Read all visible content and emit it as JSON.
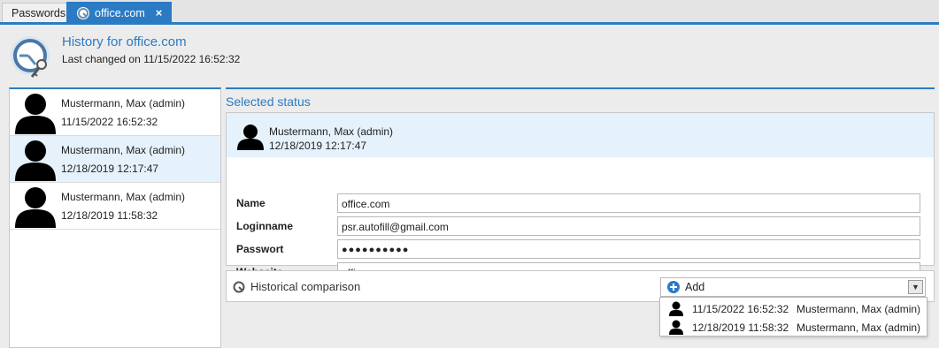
{
  "tabs": [
    {
      "label": "Passwords"
    },
    {
      "label": "office.com",
      "close": "×"
    }
  ],
  "header": {
    "title": "History for office.com",
    "subtitle": "Last changed on 11/15/2022 16:52:32"
  },
  "history": [
    {
      "user": "Mustermann, Max (admin)",
      "date": "11/15/2022 16:52:32"
    },
    {
      "user": "Mustermann, Max (admin)",
      "date": "12/18/2019 12:17:47"
    },
    {
      "user": "Mustermann, Max (admin)",
      "date": "12/18/2019 11:58:32"
    }
  ],
  "selected_status": {
    "title": "Selected status",
    "user": "Mustermann, Max (admin)",
    "date": "12/18/2019 12:17:47",
    "fields": [
      {
        "label": "Name",
        "value": "office.com"
      },
      {
        "label": "Loginname",
        "value": "psr.autofill@gmail.com"
      },
      {
        "label": "Passwort",
        "value": "●●●●●●●●●●"
      },
      {
        "label": "Webseite",
        "value": "office.com"
      }
    ]
  },
  "comparison": {
    "label": "Historical comparison",
    "add_label": "Add",
    "options": [
      {
        "date": "11/15/2022 16:52:32",
        "user": "Mustermann, Max (admin)"
      },
      {
        "date": "12/18/2019 11:58:32",
        "user": "Mustermann, Max (admin)"
      }
    ]
  },
  "colors": {
    "accent": "#2b7bc4",
    "selection": "#e5f1fb"
  }
}
